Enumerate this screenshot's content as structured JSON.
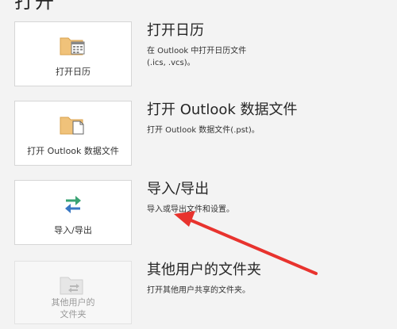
{
  "page_title": "打开",
  "options": [
    {
      "tile_label": "打开日历",
      "title": "打开日历",
      "description": "在 Outlook 中打开日历文件\n(.ics, .vcs)。",
      "icon": "calendar-folder-icon"
    },
    {
      "tile_label": "打开 Outlook 数据文件",
      "title": "打开 Outlook 数据文件",
      "description": "打开 Outlook 数据文件(.pst)。",
      "icon": "data-file-folder-icon"
    },
    {
      "tile_label": "导入/导出",
      "title": "导入/导出",
      "description": "导入或导出文件和设置。",
      "icon": "import-export-arrows-icon"
    },
    {
      "tile_label": "其他用户的\n文件夹",
      "title": "其他用户的文件夹",
      "description": "打开其他用户共享的文件夹。",
      "icon": "shared-folder-icon"
    }
  ],
  "colors": {
    "background": "#f3f3f3",
    "tile": "#ffffff",
    "annotation_arrow": "#e8332e",
    "icon_green": "#3aa374",
    "icon_blue": "#3a78c4",
    "folder": "#e9b96e"
  }
}
